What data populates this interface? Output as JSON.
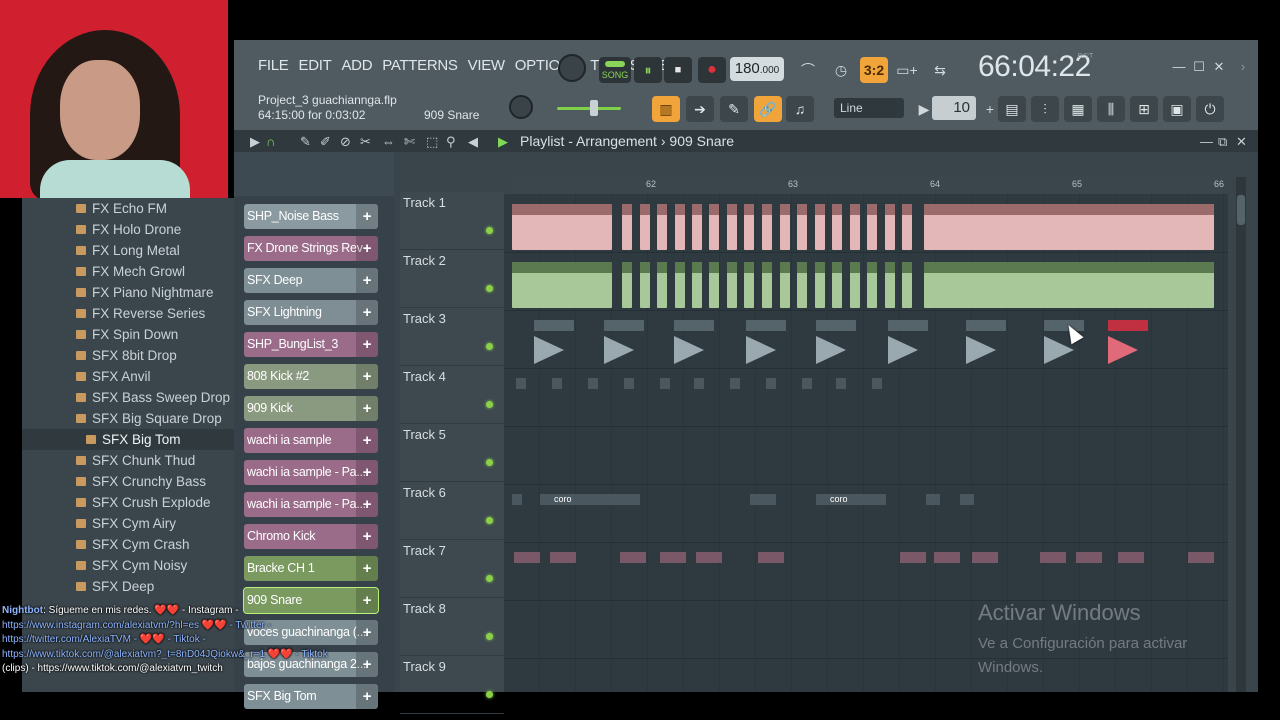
{
  "menu": [
    "FILE",
    "EDIT",
    "ADD",
    "PATTERNS",
    "VIEW",
    "OPTIONS",
    "TOOLS",
    "HELP"
  ],
  "transport": {
    "mode_label": "SONG",
    "bpm": "180",
    "bpm_decimal": ".000"
  },
  "time": {
    "value": "66:04:22",
    "unit_label": "B:S:T"
  },
  "project": {
    "name": "Project_3 guachiannga.flp",
    "position": "64:15:00 for 0:03:02",
    "hint": "909 Snare"
  },
  "snap": {
    "mode": "Line",
    "value": "10"
  },
  "playlist": {
    "title": "Playlist - Arrangement",
    "pattern": "909 Snare"
  },
  "ruler_marks": [
    "62",
    "63",
    "64",
    "65",
    "66"
  ],
  "browser": {
    "items": [
      "FX Echo FM",
      "FX Holo Drone",
      "FX Long Metal",
      "FX Mech Growl",
      "FX Piano Nightmare",
      "FX Reverse Series",
      "FX Spin Down",
      "SFX 8bit Drop",
      "SFX Anvil",
      "SFX Bass Sweep Drop",
      "SFX Big Square Drop",
      "SFX Big Tom",
      "SFX Chunk Thud",
      "SFX Crunchy Bass",
      "SFX Crush Explode",
      "SFX Cym Airy",
      "SFX Cym Crash",
      "SFX Cym Noisy",
      "SFX Deep"
    ],
    "selected": 11
  },
  "channels": [
    {
      "name": "SHP_Noise Bass",
      "color": "#8a9aa0"
    },
    {
      "name": "FX Drone Strings Rev",
      "color": "#9b6b8a"
    },
    {
      "name": "SFX Deep",
      "color": "#7e8f95"
    },
    {
      "name": "SFX Lightning",
      "color": "#7f8e94"
    },
    {
      "name": "SHP_BungList_3",
      "color": "#9b6b8a"
    },
    {
      "name": "808 Kick #2",
      "color": "#8a9a80"
    },
    {
      "name": "909 Kick",
      "color": "#8a9a80"
    },
    {
      "name": "wachi ia sample",
      "color": "#9b6b8a"
    },
    {
      "name": "wachi ia sample - Pa...",
      "color": "#9b6b8a"
    },
    {
      "name": "wachi ia sample - Pa...",
      "color": "#9b6b8a"
    },
    {
      "name": "Chromo Kick",
      "color": "#9b6b8a"
    },
    {
      "name": "Bracke CH 1",
      "color": "#7a9a60"
    },
    {
      "name": "909 Snare",
      "color": "#7a9a60"
    },
    {
      "name": "voces guachinanga (...",
      "color": "#7e8f95"
    },
    {
      "name": "bajos guachinanga 2...",
      "color": "#7e8f95"
    },
    {
      "name": "SFX Big Tom",
      "color": "#7e8f95"
    }
  ],
  "tracks": [
    "Track 1",
    "Track 2",
    "Track 3",
    "Track 4",
    "Track 5",
    "Track 6",
    "Track 7",
    "Track 8",
    "Track 9"
  ],
  "clip_labels": {
    "coro_a": "coro",
    "coro_b": "coro"
  },
  "watermark": {
    "title": "Activar Windows",
    "body": "Ve a Configuración para activar Windows."
  },
  "chat": {
    "line1_user": "Nightbot",
    "line1_text": ": Sígueme en mis redes. ❤️❤️ - Instagram -",
    "line2": "https://www.instagram.com/alexiatvm/?hl=es ❤️❤️ - Twitter -",
    "line3": "https://twitter.com/AlexiaTVM - ❤️❤️ - Tiktok -",
    "line4": "https://www.tiktok.com/@alexiatvm?_t=8nD04JQiokw&_r=1 ❤️❤️ - Tiktok",
    "line5": "(clips) - https://www.tiktok.com/@alexiatvm_twitch"
  },
  "colors": {
    "accent_orange": "#f0a43a",
    "led_green": "#8ad048",
    "pattern_pink": "#e8b8b8",
    "pattern_green": "#b8d8a8"
  }
}
